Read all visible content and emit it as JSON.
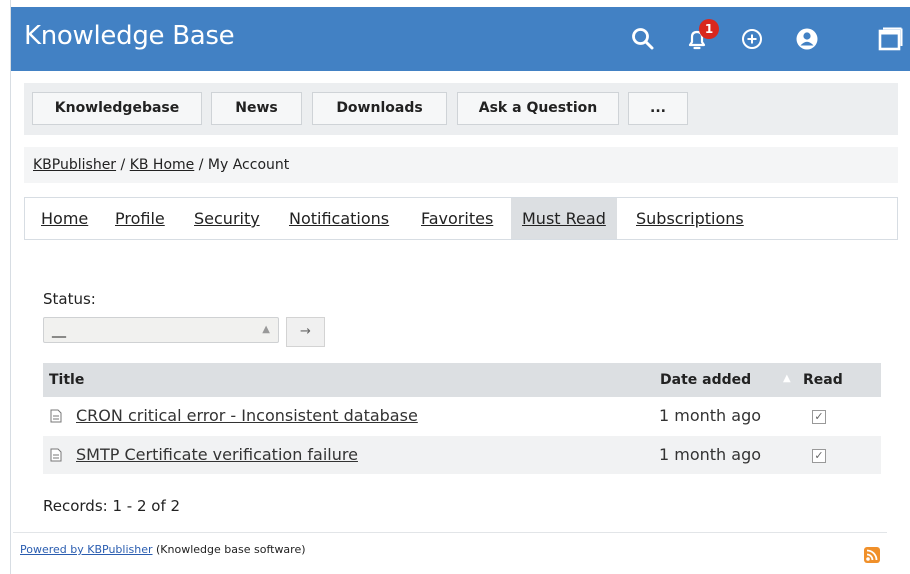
{
  "header": {
    "title": "Knowledge Base",
    "notification_count": "1",
    "icons": [
      "search-icon",
      "bell-icon",
      "add-circle-icon",
      "user-icon",
      "window-icon"
    ]
  },
  "topnav": {
    "items": [
      "Knowledgebase",
      "News",
      "Downloads",
      "Ask a Question",
      "..."
    ]
  },
  "breadcrumb": {
    "items": [
      "KBPublisher",
      "KB Home",
      "My Account"
    ],
    "separator": "/"
  },
  "account_tabs": {
    "items": [
      "Home",
      "Profile",
      "Security",
      "Notifications",
      "Favorites",
      "Must Read",
      "Subscriptions"
    ],
    "active": "Must Read"
  },
  "filter": {
    "status_label": "Status:",
    "status_value": "__",
    "go_label": "→"
  },
  "table": {
    "columns": [
      "Title",
      "Date added",
      "Read"
    ],
    "rows": [
      {
        "title": "CRON critical error - Inconsistent database",
        "date": "1 month ago",
        "read": "✓"
      },
      {
        "title": "SMTP Certificate verification failure",
        "date": "1 month ago",
        "read": "✓"
      }
    ]
  },
  "records": "Records: 1 - 2 of 2",
  "footer": {
    "link": "Powered by KBPublisher",
    "text": " (Knowledge base software)"
  },
  "colors": {
    "header_bg": "#4281c4",
    "badge": "#d9271e",
    "rss": "#f0902a"
  }
}
